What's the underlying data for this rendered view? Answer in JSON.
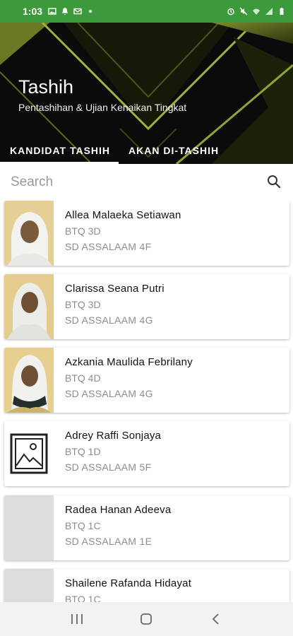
{
  "status_bar": {
    "time": "1:03",
    "left_icons": [
      "image-icon",
      "notification-icon",
      "mail-icon",
      "dot-icon"
    ],
    "right_icons": [
      "alarm-icon",
      "mute-icon",
      "wifi-icon",
      "signal-icon",
      "battery-icon"
    ],
    "color": "#3c9a3c"
  },
  "header": {
    "title": "Tashih",
    "subtitle": "Pentashihan & Ujian Kenaikan Tingkat",
    "accent": "#8fa33a"
  },
  "tabs": [
    {
      "label": "KANDIDAT TASHIH",
      "active": true
    },
    {
      "label": "AKAN DI-TASHIH",
      "active": false
    }
  ],
  "search": {
    "placeholder": "Search",
    "value": ""
  },
  "students": [
    {
      "name": "Allea Malaeka Setiawan",
      "level": "BTQ 3D",
      "school": "SD ASSALAAM 4F",
      "thumb": "photo"
    },
    {
      "name": "Clarissa Seana Putri",
      "level": "BTQ 3D",
      "school": "SD ASSALAAM 4G",
      "thumb": "photo"
    },
    {
      "name": "Azkania Maulida Febrilany",
      "level": "BTQ 4D",
      "school": "SD ASSALAAM 4G",
      "thumb": "photo"
    },
    {
      "name": "Adrey Raffi Sonjaya",
      "level": "BTQ 1D",
      "school": "SD ASSALAAM 5F",
      "thumb": "image-placeholder"
    },
    {
      "name": "Radea Hanan Adeeva",
      "level": "BTQ 1C",
      "school": "SD ASSALAAM 1E",
      "thumb": "blank"
    },
    {
      "name": "Shailene Rafanda Hidayat",
      "level": "BTQ 1C",
      "school": "",
      "thumb": "blank"
    }
  ],
  "nav": [
    "recent-apps-icon",
    "home-icon",
    "back-icon"
  ]
}
